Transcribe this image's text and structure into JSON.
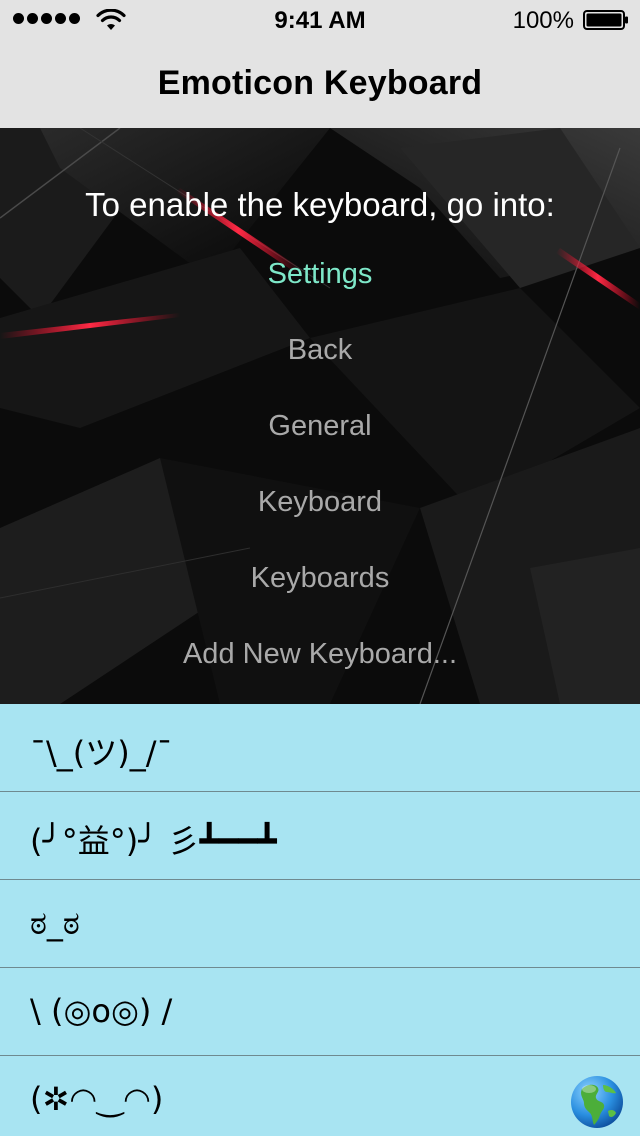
{
  "status_bar": {
    "time": "9:41 AM",
    "battery_percent": "100%",
    "signal_bars": 5,
    "icons": [
      "signal-dots-icon",
      "wifi-icon",
      "battery-icon"
    ]
  },
  "nav": {
    "title": "Emoticon Keyboard"
  },
  "instructions": {
    "heading": "To enable the keyboard, go into:",
    "steps": [
      {
        "label": "Settings",
        "active": true
      },
      {
        "label": "Back",
        "active": false
      },
      {
        "label": "General",
        "active": false
      },
      {
        "label": "Keyboard",
        "active": false
      },
      {
        "label": "Keyboards",
        "active": false
      },
      {
        "label": "Add New Keyboard...",
        "active": false
      }
    ]
  },
  "emoticons": [
    "¯\\_(ツ)_/¯",
    "(╯°益°)╯ 彡┻━━┻",
    "ಠ_ಠ",
    "\\ (◎o◎) /",
    "(✲◠‿◠)"
  ],
  "colors": {
    "nav_background": "#e3e3e3",
    "panel_background": "#0c0c0c",
    "active_step": "#7ee8c9",
    "inactive_step": "#a9a9a9",
    "list_background": "#a8e4f2",
    "separator": "#6f8a90"
  },
  "globe_icon": "globe-americas-icon"
}
